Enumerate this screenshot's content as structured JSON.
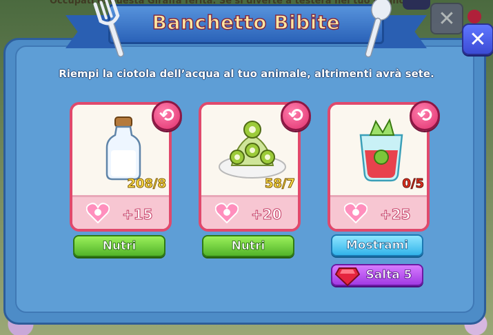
{
  "background": {
    "caption": "Occupati di questa Giraffa ferita. Se si diverte a testera nel tuo Regno!"
  },
  "dialog": {
    "title": "Banchetto Bibite",
    "instructions": "Riempi la ciotola dell’acqua al tuo animale, altrimenti avrà sete.",
    "close_icon": "close-icon"
  },
  "cards": [
    {
      "item": "milk-bottle-icon",
      "count": "208/8",
      "status": "ok",
      "reward": "+15",
      "button": "Nutri"
    },
    {
      "item": "kiwi-plate-icon",
      "count": "58/7",
      "status": "ok",
      "reward": "+20",
      "button": "Nutri"
    },
    {
      "item": "fruit-drink-icon",
      "count": "0/5",
      "status": "missing",
      "reward": "+25",
      "button": "Mostrami",
      "skip_button": "Salta 5"
    }
  ],
  "colors": {
    "panel": "#5e9ed6",
    "card_border": "#e0496c",
    "button_green": "#52b42a",
    "button_blue": "#33b4ea",
    "button_purple": "#a13ae3"
  }
}
